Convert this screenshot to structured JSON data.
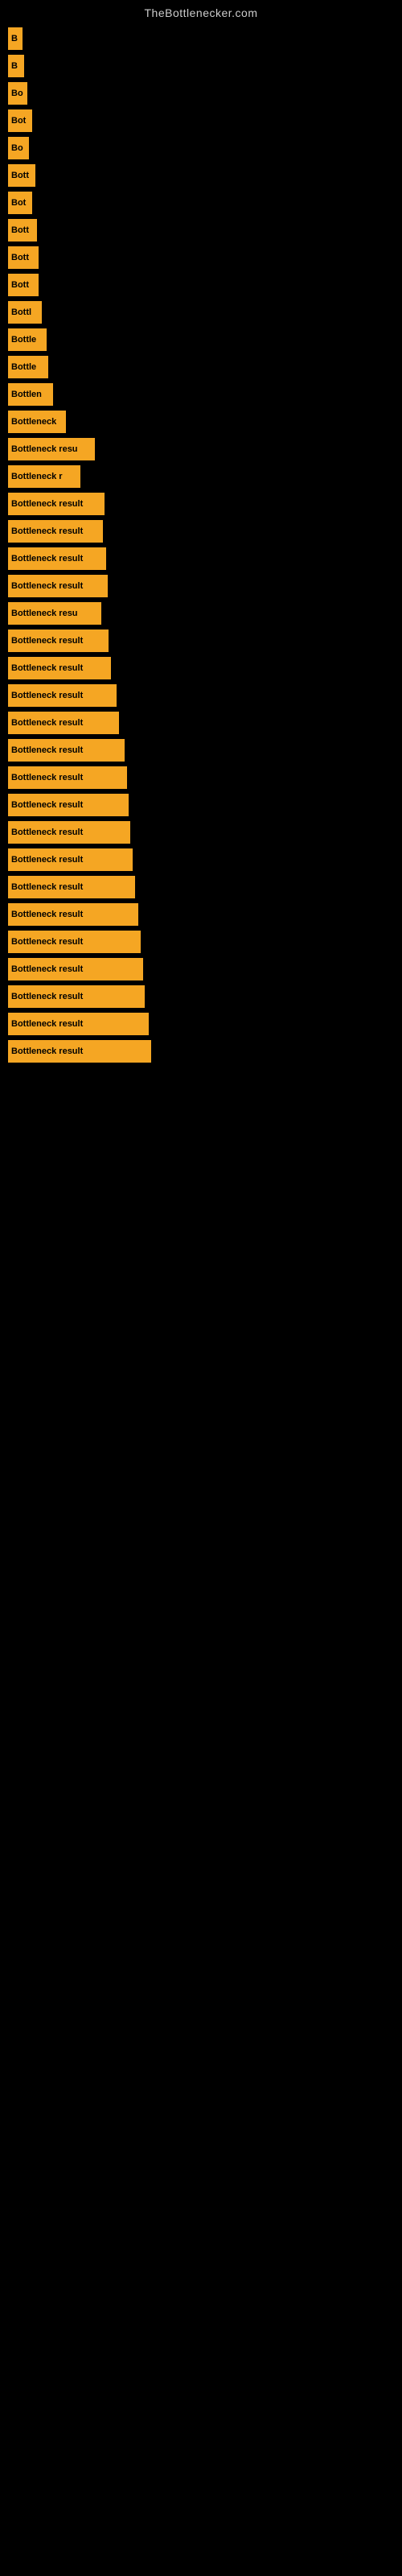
{
  "site_title": "TheBottlenecker.com",
  "bars": [
    {
      "label": "B",
      "width": 18
    },
    {
      "label": "B",
      "width": 20
    },
    {
      "label": "Bo",
      "width": 24
    },
    {
      "label": "Bot",
      "width": 30
    },
    {
      "label": "Bo",
      "width": 26
    },
    {
      "label": "Bott",
      "width": 34
    },
    {
      "label": "Bot",
      "width": 30
    },
    {
      "label": "Bott",
      "width": 36
    },
    {
      "label": "Bott",
      "width": 38
    },
    {
      "label": "Bott",
      "width": 38
    },
    {
      "label": "Bottl",
      "width": 42
    },
    {
      "label": "Bottle",
      "width": 48
    },
    {
      "label": "Bottle",
      "width": 50
    },
    {
      "label": "Bottlen",
      "width": 56
    },
    {
      "label": "Bottleneck",
      "width": 72
    },
    {
      "label": "Bottleneck resu",
      "width": 108
    },
    {
      "label": "Bottleneck r",
      "width": 90
    },
    {
      "label": "Bottleneck result",
      "width": 120
    },
    {
      "label": "Bottleneck result",
      "width": 118
    },
    {
      "label": "Bottleneck result",
      "width": 122
    },
    {
      "label": "Bottleneck result",
      "width": 124
    },
    {
      "label": "Bottleneck resu",
      "width": 116
    },
    {
      "label": "Bottleneck result",
      "width": 125
    },
    {
      "label": "Bottleneck result",
      "width": 128
    },
    {
      "label": "Bottleneck result",
      "width": 135
    },
    {
      "label": "Bottleneck result",
      "width": 138
    },
    {
      "label": "Bottleneck result",
      "width": 145
    },
    {
      "label": "Bottleneck result",
      "width": 148
    },
    {
      "label": "Bottleneck result",
      "width": 150
    },
    {
      "label": "Bottleneck result",
      "width": 152
    },
    {
      "label": "Bottleneck result",
      "width": 155
    },
    {
      "label": "Bottleneck result",
      "width": 158
    },
    {
      "label": "Bottleneck result",
      "width": 162
    },
    {
      "label": "Bottleneck result",
      "width": 165
    },
    {
      "label": "Bottleneck result",
      "width": 168
    },
    {
      "label": "Bottleneck result",
      "width": 170
    },
    {
      "label": "Bottleneck result",
      "width": 175
    },
    {
      "label": "Bottleneck result",
      "width": 178
    }
  ]
}
